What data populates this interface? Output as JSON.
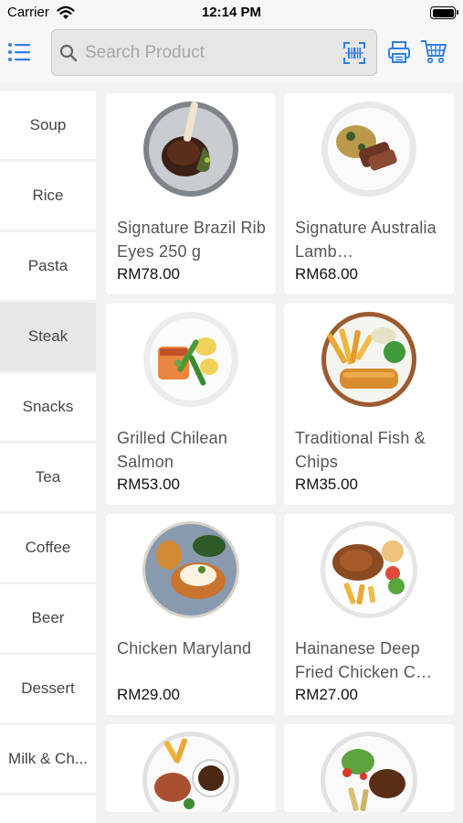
{
  "status_bar": {
    "carrier": "Carrier",
    "time": "12:14 PM"
  },
  "search": {
    "placeholder": "Search Product"
  },
  "categories": [
    {
      "label": "Soup"
    },
    {
      "label": "Rice"
    },
    {
      "label": "Pasta"
    },
    {
      "label": "Steak",
      "active": true
    },
    {
      "label": "Snacks"
    },
    {
      "label": "Tea"
    },
    {
      "label": "Coffee"
    },
    {
      "label": "Beer"
    },
    {
      "label": "Dessert"
    },
    {
      "label": "Milk & Ch..."
    },
    {
      "label": ""
    }
  ],
  "products": [
    {
      "name": "Signature Brazil Rib Eyes 250 g",
      "price": "RM78.00",
      "image": "rib-eye-steak-plate"
    },
    {
      "name": "Signature Australia Lamb…",
      "price": "RM68.00",
      "image": "lamb-steak-pasta-plate"
    },
    {
      "name": "Grilled Chilean Salmon",
      "price": "RM53.00",
      "image": "salmon-vegetables-plate"
    },
    {
      "name": "Traditional Fish & Chips",
      "price": "RM35.00",
      "image": "fish-and-chips-plate"
    },
    {
      "name": "Chicken Maryland",
      "price": "RM29.00",
      "image": "chicken-maryland-plate"
    },
    {
      "name": "Hainanese Deep Fried Chicken C…",
      "price": "RM27.00",
      "image": "hainanese-chicken-chop-plate"
    },
    {
      "name": "",
      "price": "",
      "image": "chicken-chop-fries-gravy-plate"
    },
    {
      "name": "",
      "price": "",
      "image": "steak-salad-fries-plate"
    }
  ],
  "colors": {
    "accent": "#2f7fe6",
    "background": "#f2f2f2",
    "card": "#ffffff",
    "active_category": "#e7e7e7"
  }
}
